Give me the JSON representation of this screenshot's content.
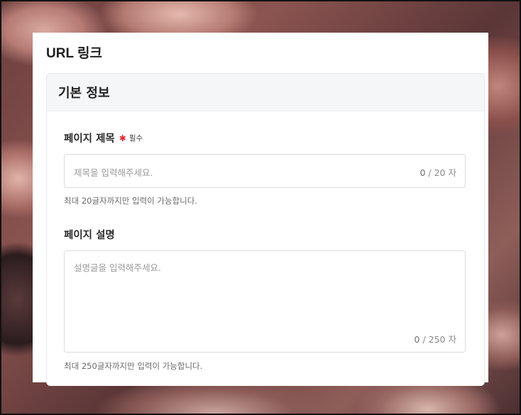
{
  "page": {
    "title": "URL 링크"
  },
  "section": {
    "title": "기본 정보"
  },
  "fields": {
    "title": {
      "label": "페이지 제목",
      "required_label": "필수",
      "placeholder": "제목을 입력해주세요.",
      "count": "0",
      "max_label": "/ 20 자",
      "hint": "최대 20글자까지만 입력이 가능합니다."
    },
    "description": {
      "label": "페이지 설명",
      "placeholder": "설명글을 입력해주세요.",
      "count": "0",
      "max_label": "/ 250 자",
      "hint": "최대 250글자까지만 입력이 가능합니다."
    }
  },
  "icons": {
    "required": "asterisk-icon"
  },
  "colors": {
    "required": "#e0262d",
    "section_header_bg": "#f5f6f8"
  }
}
